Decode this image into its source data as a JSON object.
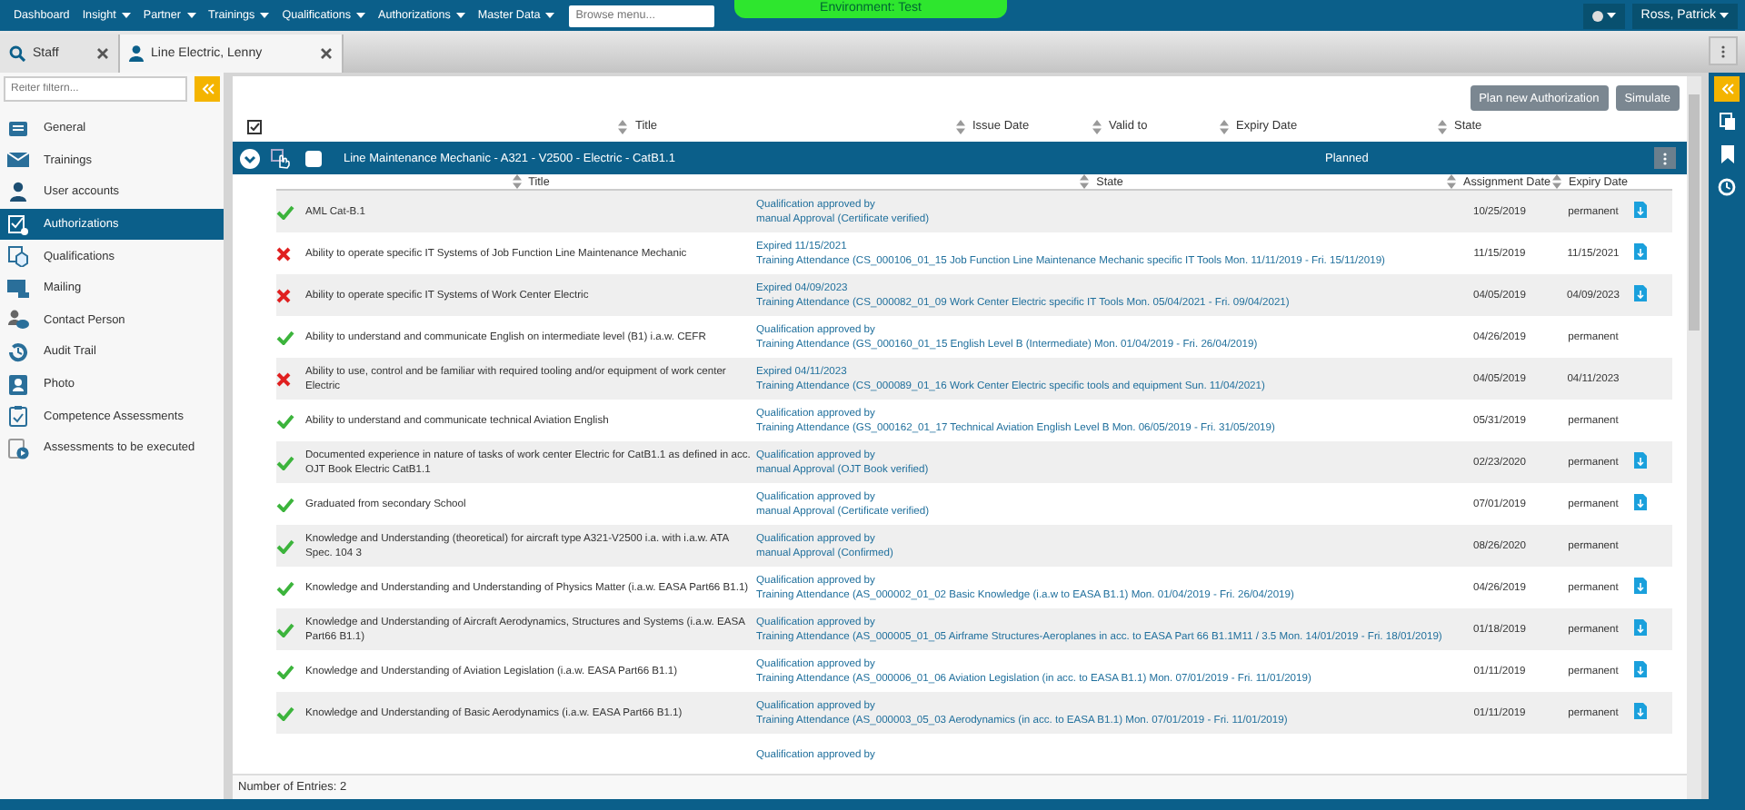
{
  "menu": [
    {
      "label": "Dashboard",
      "dropdown": false
    },
    {
      "label": "Insight",
      "dropdown": true
    },
    {
      "label": "Partner",
      "dropdown": true
    },
    {
      "label": "Trainings",
      "dropdown": true
    },
    {
      "label": "Qualifications",
      "dropdown": true
    },
    {
      "label": "Authorizations",
      "dropdown": true
    },
    {
      "label": "Master Data",
      "dropdown": true
    }
  ],
  "search": {
    "placeholder": "Browse menu..."
  },
  "environment": "Environment: Test",
  "user": "Ross, Patrick",
  "tabs": [
    {
      "kind": "search",
      "label": "Staff",
      "selected": false
    },
    {
      "kind": "person",
      "label": "Line Electric, Lenny",
      "selected": true
    }
  ],
  "sidebar": {
    "filter_placeholder": "Reiter filtern...",
    "items": [
      {
        "label": "General",
        "selected": false
      },
      {
        "label": "Trainings",
        "selected": false
      },
      {
        "label": "User accounts",
        "selected": false
      },
      {
        "label": "Authorizations",
        "selected": true
      },
      {
        "label": "Qualifications",
        "selected": false
      },
      {
        "label": "Mailing",
        "selected": false
      },
      {
        "label": "Contact Person",
        "selected": false
      },
      {
        "label": "Audit Trail",
        "selected": false
      },
      {
        "label": "Photo",
        "selected": false
      },
      {
        "label": "Competence Assessments",
        "selected": false
      },
      {
        "label": "Assessments to be executed",
        "selected": false
      }
    ]
  },
  "buttons": [
    "Plan new Authorization",
    "Simulate"
  ],
  "columns": [
    "Title",
    "Issue Date",
    "Valid to",
    "Expiry Date",
    "State"
  ],
  "group": {
    "title": "Line Maintenance Mechanic - A321 - V2500 - Electric - CatB1.1",
    "state": "Planned",
    "expanded": true,
    "checked": false
  },
  "sub_columns": [
    "Title",
    "State",
    "Assignment Date",
    "Expiry Date"
  ],
  "rows": [
    {
      "passed": true,
      "title": "AML Cat-B.1",
      "state": [
        "Qualification approved by",
        "manual Approval (Certificate verified)"
      ],
      "assignment_date": "10/25/2019",
      "expiry_date": "permanent",
      "document": true
    },
    {
      "passed": false,
      "title": "Ability to operate specific IT Systems of Job Function Line Maintenance Mechanic",
      "state": [
        "Expired 11/15/2021",
        "Training Attendance (CS_000106_01_15 Job Function Line Maintenance Mechanic specific IT Tools Mon. 11/11/2019 - Fri. 15/11/2019)"
      ],
      "assignment_date": "11/15/2019",
      "expiry_date": "11/15/2021",
      "document": true
    },
    {
      "passed": false,
      "title": "Ability to operate specific IT Systems of Work Center Electric",
      "state": [
        "Expired 04/09/2023",
        "Training Attendance (CS_000082_01_09 Work Center Electric specific IT Tools Mon. 05/04/2021 - Fri. 09/04/2021)"
      ],
      "assignment_date": "04/05/2019",
      "expiry_date": "04/09/2023",
      "document": true
    },
    {
      "passed": true,
      "title": "Ability to understand and communicate English on intermediate level (B1) i.a.w. CEFR",
      "state": [
        "Qualification approved by",
        "Training Attendance (GS_000160_01_15 English Level B (Intermediate) Mon. 01/04/2019 - Fri. 26/04/2019)"
      ],
      "assignment_date": "04/26/2019",
      "expiry_date": "permanent",
      "document": false
    },
    {
      "passed": false,
      "title": "Ability to use, control and be familiar with required tooling and/or equipment of work center Electric",
      "state": [
        "Expired 04/11/2023",
        "Training Attendance (CS_000089_01_16 Work Center Electric specific tools and equipment Sun. 11/04/2021)"
      ],
      "assignment_date": "04/05/2019",
      "expiry_date": "04/11/2023",
      "document": false
    },
    {
      "passed": true,
      "title": "Ability to understand and communicate technical Aviation English",
      "state": [
        "Qualification approved by",
        "Training Attendance (GS_000162_01_17 Technical Aviation English Level B Mon. 06/05/2019 - Fri. 31/05/2019)"
      ],
      "assignment_date": "05/31/2019",
      "expiry_date": "permanent",
      "document": false
    },
    {
      "passed": true,
      "title": "Documented experience in nature of tasks of work center Electric for CatB1.1 as defined in acc. OJT Book Electric CatB1.1",
      "state": [
        "Qualification approved by",
        "manual Approval (OJT Book verified)"
      ],
      "assignment_date": "02/23/2020",
      "expiry_date": "permanent",
      "document": true
    },
    {
      "passed": true,
      "title": "Graduated from secondary School",
      "state": [
        "Qualification approved by",
        "manual Approval (Certificate verified)"
      ],
      "assignment_date": "07/01/2019",
      "expiry_date": "permanent",
      "document": true
    },
    {
      "passed": true,
      "title": "Knowledge and Understanding (theoretical) for aircraft type A321-V2500 i.a. with i.a.w. ATA Spec. 104 3",
      "state": [
        "Qualification approved by",
        "manual Approval (Confirmed)"
      ],
      "assignment_date": "08/26/2020",
      "expiry_date": "permanent",
      "document": false
    },
    {
      "passed": true,
      "title": "Knowledge and Understanding and Understanding of Physics Matter (i.a.w. EASA Part66 B1.1)",
      "state": [
        "Qualification approved by",
        "Training Attendance (AS_000002_01_02 Basic Knowledge (i.a.w to EASA B1.1) Mon. 01/04/2019 - Fri. 26/04/2019)"
      ],
      "assignment_date": "04/26/2019",
      "expiry_date": "permanent",
      "document": true
    },
    {
      "passed": true,
      "title": "Knowledge and Understanding of Aircraft Aerodynamics, Structures and Systems (i.a.w. EASA Part66 B1.1)",
      "state": [
        "Qualification approved by",
        "Training Attendance (AS_000005_01_05 Airframe Structures-Aeroplanes in acc. to EASA Part 66 B1.1M11 / 3.5 Mon. 14/01/2019 - Fri. 18/01/2019)"
      ],
      "assignment_date": "01/18/2019",
      "expiry_date": "permanent",
      "document": true
    },
    {
      "passed": true,
      "title": "Knowledge and Understanding of Aviation Legislation (i.a.w. EASA Part66 B1.1)",
      "state": [
        "Qualification approved by",
        "Training Attendance (AS_000006_01_06 Aviation Legislation (in acc. to EASA B1.1) Mon. 07/01/2019 - Fri. 11/01/2019)"
      ],
      "assignment_date": "01/11/2019",
      "expiry_date": "permanent",
      "document": true
    },
    {
      "passed": true,
      "title": "Knowledge and Understanding of Basic Aerodynamics (i.a.w. EASA Part66 B1.1)",
      "state": [
        "Qualification approved by",
        "Training Attendance (AS_000003_05_03 Aerodynamics (in acc. to EASA B1.1) Mon. 07/01/2019 - Fri. 11/01/2019)"
      ],
      "assignment_date": "01/11/2019",
      "expiry_date": "permanent",
      "document": true
    },
    {
      "state": [
        "Qualification approved by"
      ],
      "document": false
    }
  ],
  "footer": "Number of Entries: 2"
}
